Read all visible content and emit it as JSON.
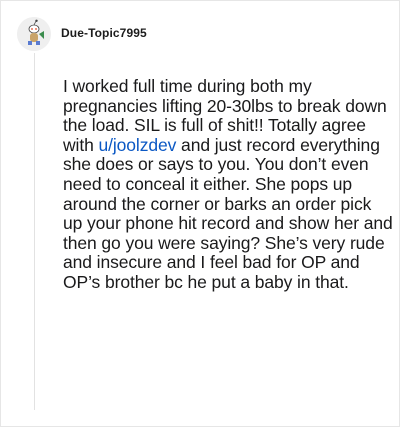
{
  "comment": {
    "author": "Due-Topic7995",
    "avatar": "reddit-snoo-avatar-icon",
    "body_part1": "I worked full time during both my pregnancies lifting 20-30lbs to break down the load. SIL is full of shit!! Totally agree with ",
    "mention": "u/joolzdev",
    "body_part2": " and just record everything she does or says to you. You don’t even need to conceal it either. She pops up around the corner or barks an order pick up your phone hit record and show her and then go you were saying? She’s very rude and insecure and I feel bad for OP and OP’s brother bc he put a baby in that."
  },
  "colors": {
    "link": "#0b58c4",
    "text": "#1a1a1b",
    "border": "#e6e6e6"
  }
}
